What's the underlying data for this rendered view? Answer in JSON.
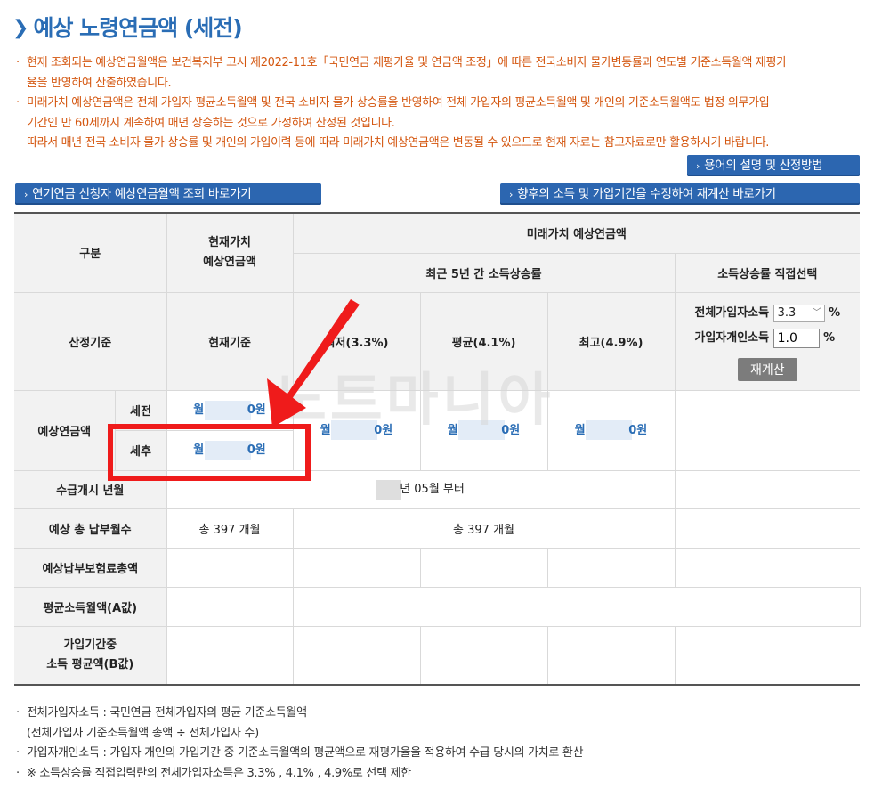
{
  "page": {
    "title": "예상 노령연금액 (세전)",
    "notes": [
      "현재 조회되는 예상연금월액은 보건복지부 고시 제2022-11호「국민연금 재평가율 및 연금액 조정」에 따른 전국소비자 물가변동률과 연도별 기준소득월액 재평가",
      "율을 반영하여 산출하였습니다.",
      "미래가치 예상연금액은 전체 가입자 평균소득월액 및 전국 소비자 물가 상승률을 반영하여 전체 가입자의 평균소득월액 및 개인의 기준소득월액도 법정 의무가입",
      "기간인 만 60세까지 계속하여 매년 상승하는 것으로 가정하여 산정된 것입니다.",
      "따라서 매년 전국 소비자 물가 상승률 및 개인의 가입이력 등에 따라 미래가치 예상연금액은 변동될 수 있으므로 현재 자료는 참고자료로만 활용하시기 바랍니다."
    ],
    "terms_button": "용어의 설명 및 산정방법",
    "pension_applicant_button": "연기연금 신청자 예상연금월액 조회 바로가기",
    "recalc_link_button": "향후의 소득 및 가입기간을 수정하여 재계산 바로가기",
    "watermark": "노트마니아"
  },
  "table": {
    "col_category": "구분",
    "col_present_value": "현재가치\n예상연금액",
    "col_future_value": "미래가치 예상연금액",
    "col_recent5": "최근 5년 간 소득상승률",
    "col_direct": "소득상승률 직접선택",
    "row_basis": "산정기준",
    "basis_present": "현재기준",
    "basis_low": "최저(3.3%)",
    "basis_avg": "평균(4.1%)",
    "basis_high": "최고(4.9%)",
    "direct": {
      "total_income_label": "전체가입자소득",
      "total_income_value": "3.3",
      "personal_income_label": "가입자개인소득",
      "personal_income_value": "1.0",
      "percent": "%",
      "recalc_button": "재계산"
    },
    "row_expected": "예상연금액",
    "pretax": "세전",
    "aftertax": "세후",
    "month_prefix": "월",
    "won_suffix": "0원",
    "row_start": "수급개시 년월",
    "start_value": "년 05월 부터",
    "row_months": "예상 총 납부월수",
    "months_present": "총 397 개월",
    "months_future": "총 397 개월",
    "row_total_premium": "예상납부보험료총액",
    "row_avg_income_a": "평균소득월액(A값)",
    "row_period_income_b_1": "가입기간중",
    "row_period_income_b_2": "소득 평균액(B값)"
  },
  "footer": [
    "전체가입자소득 : 국민연금 전체가입자의 평균 기준소득월액",
    "(전체가입자 기준소득월액 총액 ÷ 전체가입자 수)",
    "가입자개인소득 : 가입자 개인의 가입기간 중 기준소득월액의 평균액으로 재평가율을 적용하여 수급 당시의 가치로 환산",
    "※ 소득상승률 직접입력란의 전체가입자소득은 3.3% , 4.1% , 4.9%로 선택 제한"
  ],
  "colors": {
    "accent_blue": "#2a6db5",
    "note_orange": "#d4560f",
    "highlight_red": "#ef1b1b",
    "button_blue": "#2c66b0"
  }
}
